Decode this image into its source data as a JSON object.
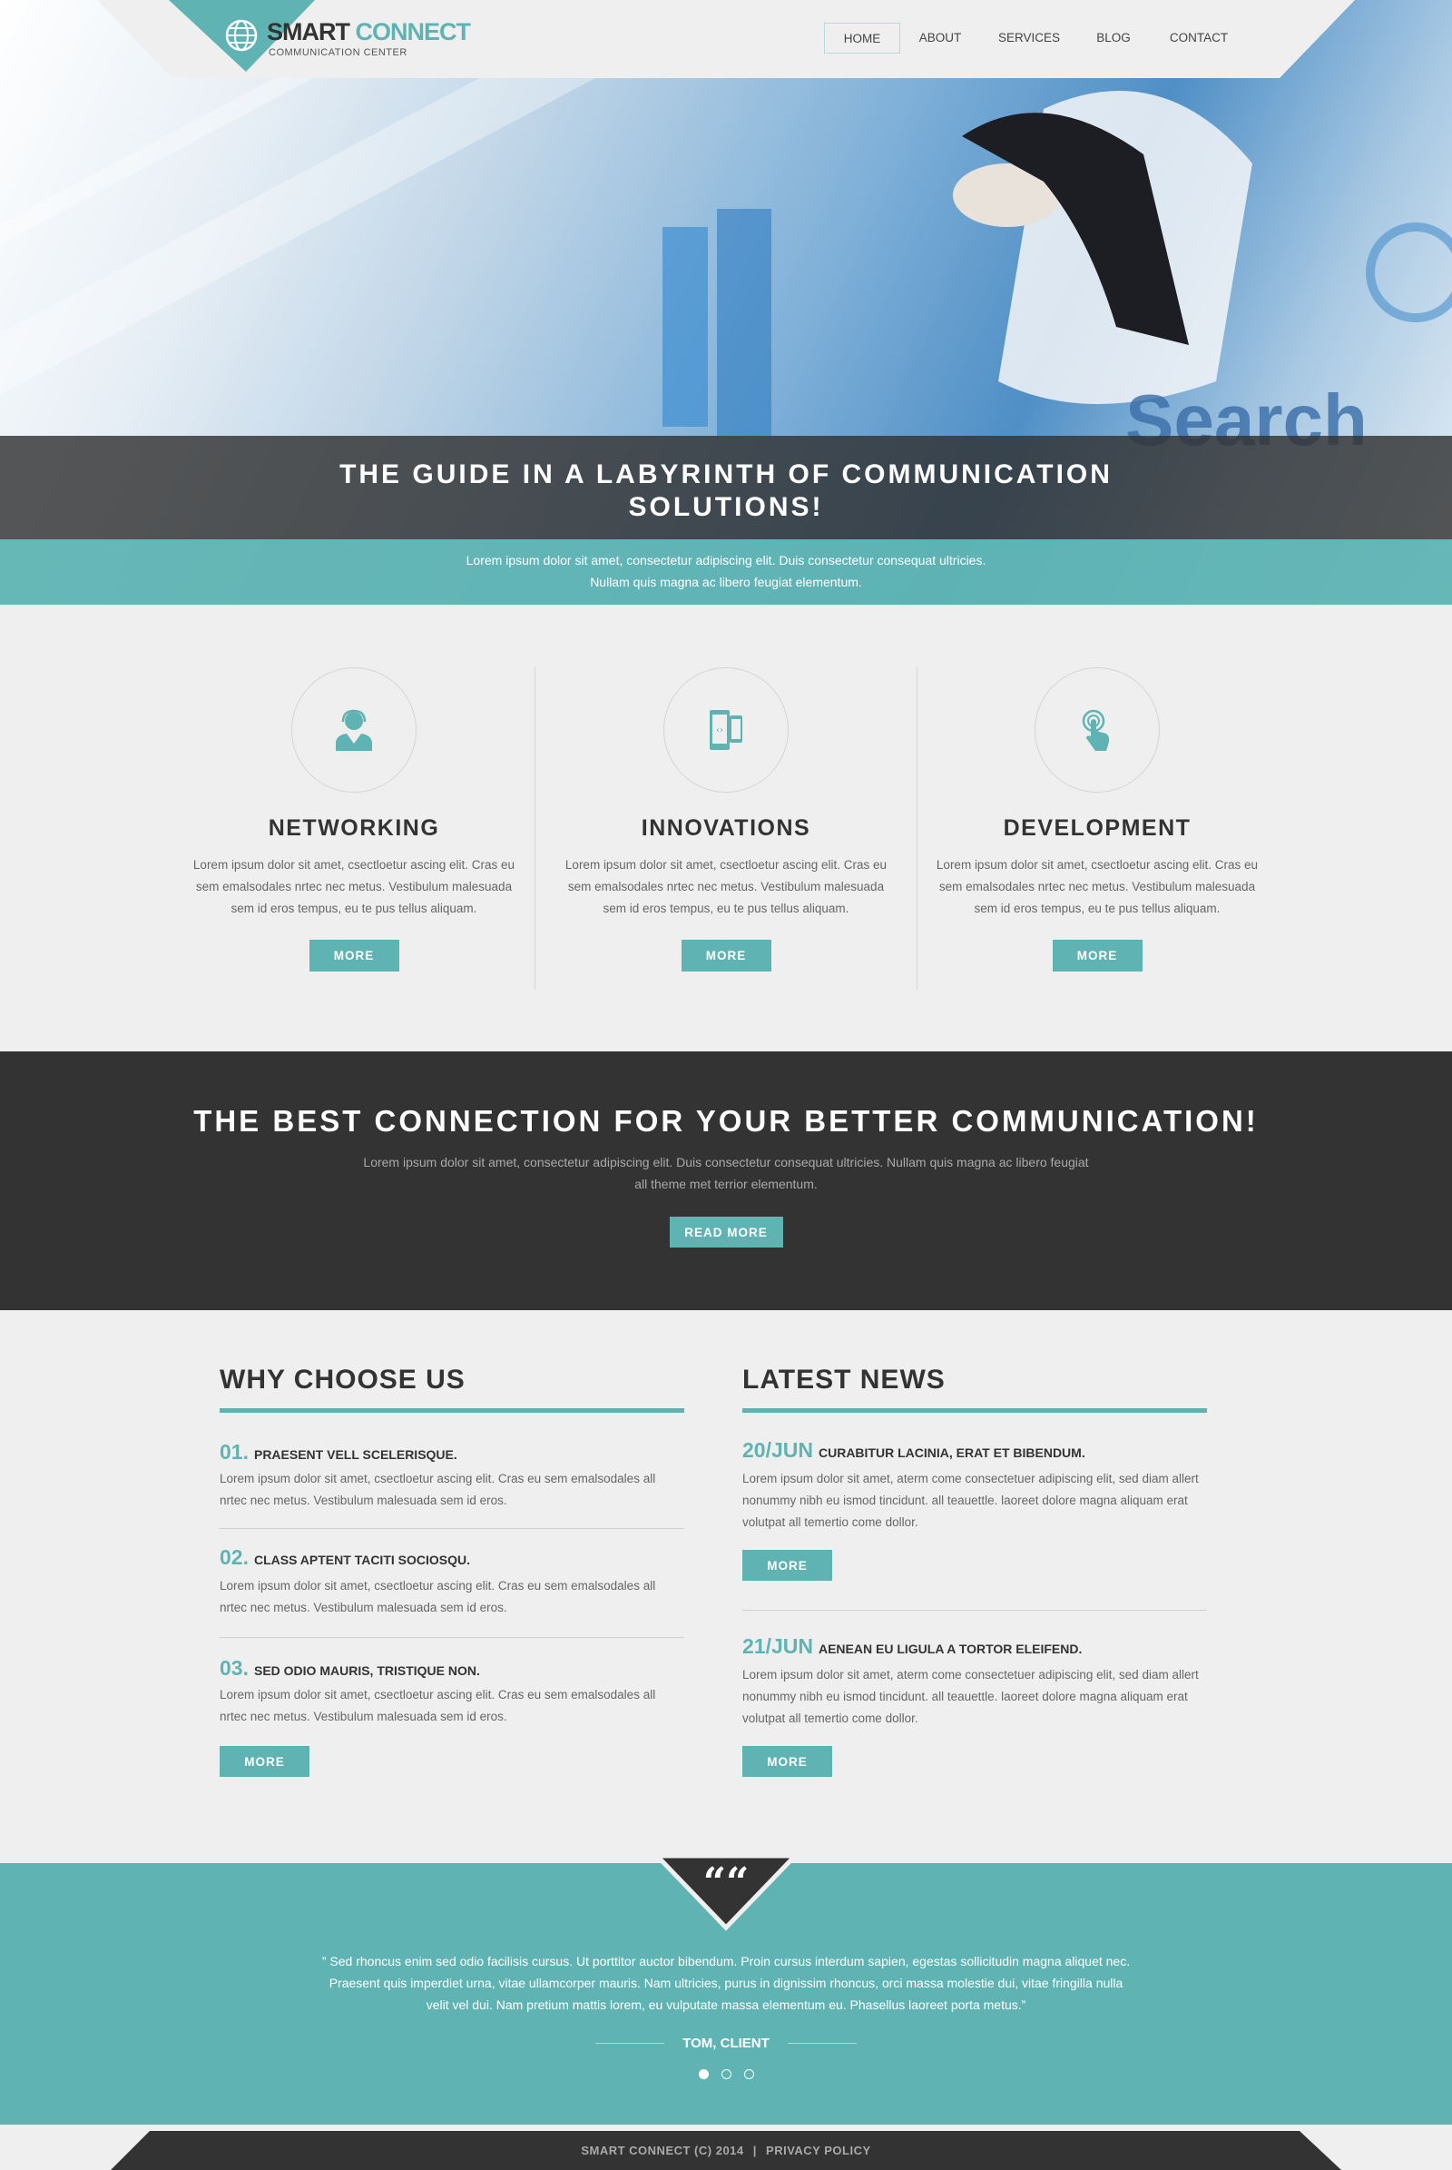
{
  "colors": {
    "accent": "#5fb4b3",
    "dark": "#333333",
    "background": "#efefef"
  },
  "header": {
    "logo": {
      "brand_part1": "SMART",
      "brand_part2": "CONNECT",
      "tagline": "COMMUNICATION CENTER",
      "icon": "globe-icon"
    },
    "nav": [
      {
        "label": "HOME",
        "active": true
      },
      {
        "label": "ABOUT"
      },
      {
        "label": "SERVICES"
      },
      {
        "label": "BLOG"
      },
      {
        "label": "CONTACT"
      }
    ]
  },
  "hero": {
    "title_line1": "THE GUIDE IN A LABYRINTH OF COMMUNICATION",
    "title_line2": "SOLUTIONS!",
    "subtitle_line1": "Lorem ipsum dolor sit amet, consectetur adipiscing elit. Duis consectetur  consequat ultricies.",
    "subtitle_line2": "Nullam quis magna ac libero feugiat elementum."
  },
  "features": [
    {
      "icon": "headset-user-icon",
      "title": "NETWORKING",
      "text": "Lorem ipsum dolor sit amet, csectloetur ascing elit. Cras eu sem emalsodales nrtec nec metus. Vestibulum malesuada sem id eros tempus, eu te pus tellus aliquam.",
      "button": "MORE"
    },
    {
      "icon": "phones-sync-icon",
      "title": "INNOVATIONS",
      "text": "Lorem ipsum dolor sit amet, csectloetur ascing elit. Cras eu sem emalsodales nrtec nec metus. Vestibulum malesuada sem id eros tempus, eu te pus tellus aliquam.",
      "button": "MORE"
    },
    {
      "icon": "touch-hand-icon",
      "title": "DEVELOPMENT",
      "text": "Lorem ipsum dolor sit amet, csectloetur ascing elit. Cras eu sem emalsodales nrtec nec metus. Vestibulum malesuada sem id eros tempus, eu te pus tellus aliquam.",
      "button": "MORE"
    }
  ],
  "promo": {
    "title": "THE BEST CONNECTION FOR YOUR BETTER COMMUNICATION!",
    "text_line1": "Lorem ipsum dolor sit amet, consectetur adipiscing elit. Duis consectetur  consequat ultricies. Nullam quis magna ac libero feugiat",
    "text_line2": "all theme met terrior elementum.",
    "button": "READ MORE"
  },
  "why": {
    "title": "WHY CHOOSE US",
    "items": [
      {
        "num": "01.",
        "title": "PRAESENT VELL SCELERISQUE.",
        "text": "Lorem ipsum dolor sit amet, csectloetur ascing elit. Cras eu sem emalsodales all nrtec nec metus. Vestibulum malesuada sem id eros."
      },
      {
        "num": "02.",
        "title": "CLASS APTENT TACITI SOCIOSQU.",
        "text": "Lorem ipsum dolor sit amet, csectloetur ascing elit. Cras eu sem emalsodales all nrtec nec metus. Vestibulum malesuada sem id eros."
      },
      {
        "num": "03.",
        "title": "SED ODIO MAURIS, TRISTIQUE NON.",
        "text": "Lorem ipsum dolor sit amet, csectloetur ascing elit. Cras eu sem emalsodales all nrtec nec metus. Vestibulum malesuada sem id eros."
      }
    ],
    "button": "MORE"
  },
  "news": {
    "title": "LATEST NEWS",
    "items": [
      {
        "date": "20/JUN",
        "title": "CURABITUR LACINIA, ERAT ET BIBENDUM.",
        "text": "Lorem ipsum dolor sit amet, aterm come consectetuer adipiscing elit, sed diam allert nonummy nibh eu ismod  tincidunt. all teauettle. laoreet dolore magna aliquam erat    volutpat all temertio come dollor.",
        "button": "MORE"
      },
      {
        "date": "21/JUN",
        "title": "AENEAN EU LIGULA A TORTOR ELEIFEND.",
        "text": "Lorem ipsum dolor sit amet, aterm come consectetuer adipiscing elit, sed diam allert nonummy nibh eu ismod  tincidunt. all teauettle. laoreet dolore magna aliquam erat    volutpat all temertio come dollor.",
        "button": "MORE"
      }
    ]
  },
  "testimonial": {
    "quote_mark": "““",
    "line1": "” Sed rhoncus enim sed odio facilisis cursus. Ut porttitor auctor bibendum. Proin cursus interdum sapien, egestas sollicitudin magna aliquet nec.",
    "line2": "Praesent quis imperdiet urna, vitae ullamcorper mauris. Nam ultricies, purus in dignissim rhoncus, orci massa molestie dui, vitae fringilla nulla",
    "line3": "velit vel dui. Nam pretium mattis lorem, eu vulputate massa elementum eu. Phasellus laoreet porta metus.”",
    "author": "TOM, CLIENT",
    "slides": 3,
    "active_slide": 1
  },
  "footer": {
    "copyright": "SMART CONNECT (C) 2014",
    "separator": "|",
    "privacy": "PRIVACY POLICY"
  }
}
